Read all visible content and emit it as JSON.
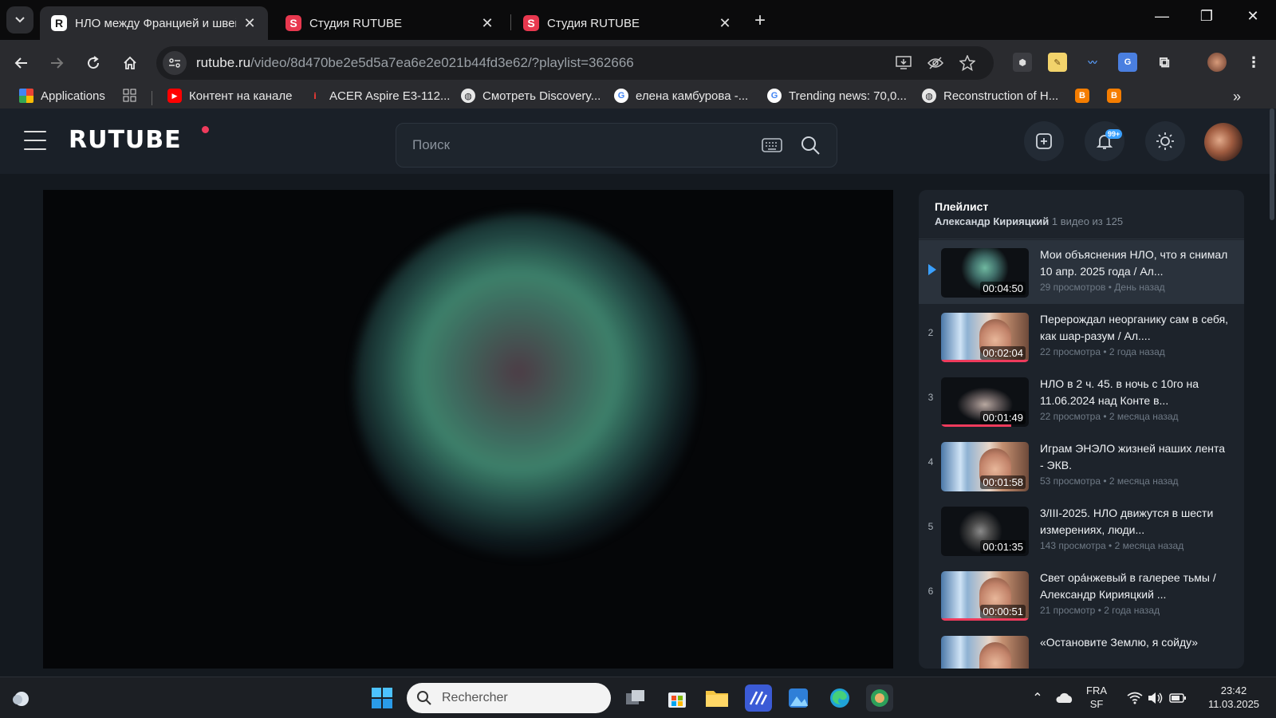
{
  "browser": {
    "tabs": [
      {
        "title": "НЛО между Францией и швей",
        "favicon": "R",
        "active": true
      },
      {
        "title": "Студия RUTUBE",
        "favicon": "S",
        "active": false
      },
      {
        "title": "Студия RUTUBE",
        "favicon": "S",
        "active": false
      }
    ],
    "new_tab": "+",
    "close_glyph": "✕",
    "window_controls": {
      "minimize": "—",
      "restore": "❐",
      "close": "✕"
    },
    "url_host": "rutube.ru",
    "url_path": "/video/8d470be2e5d5a7ea6e2e021b44fd3e62/?playlist=362666",
    "bookmarks": [
      {
        "label": "Applications",
        "icon": "apps-grid-icon"
      },
      {
        "label": "Контент на канале",
        "icon": "youtube-icon",
        "color": "#ff0000"
      },
      {
        "label": "ACER Aspire E3-112...",
        "icon": "acer-icon",
        "color": "#c62828"
      },
      {
        "label": "Смотреть Discovery...",
        "icon": "globe-icon"
      },
      {
        "label": "елена камбурова -...",
        "icon": "google-icon"
      },
      {
        "label": "Trending news: 70,0...",
        "icon": "google-icon"
      },
      {
        "label": "Reconstruction of H...",
        "icon": "globe-icon"
      }
    ],
    "bookmarks_more": "»"
  },
  "site": {
    "logo": "RUTUBE",
    "search_placeholder": "Поиск",
    "notifications_badge": "99+",
    "accent": "#ef3b5c"
  },
  "playlist": {
    "title": "Плейлист",
    "author": "Александр Кирияцкий",
    "count": "1 видео из 125",
    "items": [
      {
        "num": "",
        "title": "Мои объяснения НЛО, что я снимал 10 апр. 2025 года / Ал...",
        "duration": "00:04:50",
        "meta": "29 просмотров • День назад",
        "thumb": "ufo1",
        "active": true,
        "progress": 0
      },
      {
        "num": "2",
        "title": "Перерождал неорганику сам в себя, как шар-разум / Ал....",
        "duration": "00:02:04",
        "meta": "22 просмотра • 2 года назад",
        "thumb": "person",
        "active": false,
        "progress": 1.0
      },
      {
        "num": "3",
        "title": "НЛО в 2 ч. 45. в ночь с 10го на 11.06.2024 над Конте в...",
        "duration": "00:01:49",
        "meta": "22 просмотра • 2 месяца назад",
        "thumb": "ufo2",
        "active": false,
        "progress": 0.8
      },
      {
        "num": "4",
        "title": "Играм ЭНЭЛО жизней наших лента - ЭКВ.",
        "duration": "00:01:58",
        "meta": "53 просмотра • 2 месяца назад",
        "thumb": "person",
        "active": false,
        "progress": 0
      },
      {
        "num": "5",
        "title": "3/III-2025. НЛО движутся в шести измерениях, люди...",
        "duration": "00:01:35",
        "meta": "143 просмотра • 2 месяца назад",
        "thumb": "ufo3",
        "active": false,
        "progress": 0
      },
      {
        "num": "6",
        "title": "Свет ора́нжевый в галерее тьмы / Александр Кирияцкий ...",
        "duration": "00:00:51",
        "meta": "21 просмотр • 2 года назад",
        "thumb": "person",
        "active": false,
        "progress": 1.0
      },
      {
        "num": "",
        "title": "«Остановите Землю, я сойду»",
        "duration": "",
        "meta": "",
        "thumb": "person",
        "active": false,
        "progress": 0
      }
    ]
  },
  "taskbar": {
    "search_placeholder": "Rechercher",
    "lang_top": "FRA",
    "lang_bottom": "SF",
    "time": "23:42",
    "date": "11.03.2025"
  }
}
